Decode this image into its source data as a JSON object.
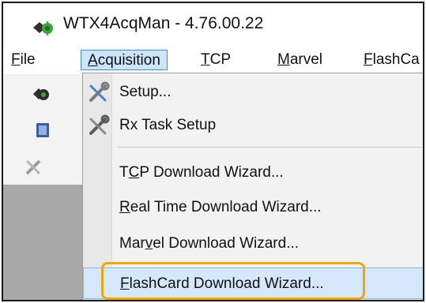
{
  "window": {
    "title": "WTX4AcqMan - 4.76.00.22",
    "app_icon": "green-gear-app-icon"
  },
  "menubar": {
    "items": [
      {
        "label": "File",
        "accel": "F",
        "rest": "ile"
      },
      {
        "label": "Acquisition",
        "accel": "A",
        "rest": "cquisition"
      },
      {
        "label": "TCP",
        "accel": "T",
        "rest": "CP"
      },
      {
        "label": "Marvel",
        "accel": "M",
        "rest": "arvel"
      },
      {
        "label": "FlashCa",
        "accel": "F",
        "rest": "lashCa"
      }
    ]
  },
  "acquisition_menu": {
    "items": [
      {
        "label": "Setup...",
        "icon": "wrench-screwdriver-icon"
      },
      {
        "label": "Rx Task Setup",
        "icon": "wrench-screwdriver-icon"
      },
      {
        "pre": "T",
        "accel": "C",
        "post": "P Download Wizard..."
      },
      {
        "pre": "",
        "accel": "R",
        "post": "eal Time Download Wizard..."
      },
      {
        "pre": "Mar",
        "accel": "v",
        "post": "el Download Wizard..."
      },
      {
        "pre": "",
        "accel": "F",
        "post": "lashCard Download Wizard..."
      }
    ]
  },
  "colors": {
    "highlight_callout": "#f0a800",
    "menu_open_bg": "#cde5fa",
    "menu_open_border": "#3c90d8",
    "item_hover_bg": "#d5e8fb"
  }
}
